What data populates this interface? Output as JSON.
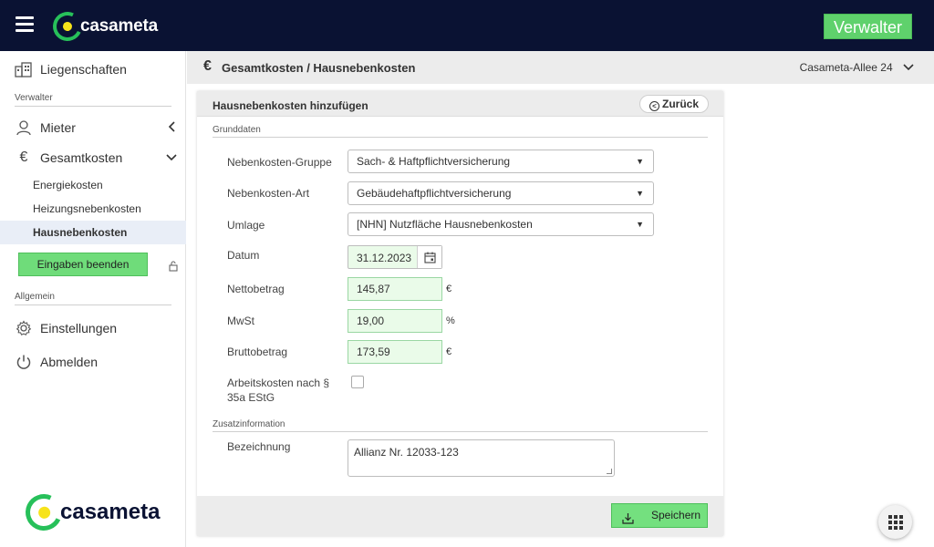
{
  "header": {
    "logo_text": "casameta",
    "role_badge": "Verwalter"
  },
  "sidebar": {
    "items": {
      "liegenschaften": "Liegenschaften",
      "mieter": "Mieter",
      "gesamtkosten": "Gesamtkosten",
      "einstellungen": "Einstellungen",
      "abmelden": "Abmelden"
    },
    "sections": {
      "verwalter": "Verwalter",
      "allgemein": "Allgemein"
    },
    "sub_items": {
      "energiekosten": "Energiekosten",
      "heizungsnebenkosten": "Heizungsnebenkosten",
      "hausnebenkosten": "Hausnebenkosten"
    },
    "finish_button": "Eingaben beenden",
    "logo_text": "casameta"
  },
  "page": {
    "currency_symbol": "€",
    "title": "Gesamtkosten / Hausnebenkosten",
    "property_selector": "Casameta-Allee 24"
  },
  "form": {
    "title": "Hausnebenkosten hinzufügen",
    "back_label": "Zurück",
    "groups": {
      "basic": "Grunddaten",
      "extra": "Zusatzinformation"
    },
    "labels": {
      "gruppe": "Nebenkosten-Gruppe",
      "art": "Nebenkosten-Art",
      "umlage": "Umlage",
      "datum": "Datum",
      "netto": "Nettobetrag",
      "mwst": "MwSt",
      "brutto": "Bruttobetrag",
      "arbeitskosten_line1": "Arbeitskosten nach §",
      "arbeitskosten_line2": "35a EStG",
      "bezeichnung": "Bezeichnung"
    },
    "values": {
      "gruppe": "Sach- & Haftpflichtversicherung",
      "art": "Gebäudehaftpflichtversicherung",
      "umlage": "[NHN] Nutzfläche Hausnebenkosten",
      "datum": "31.12.2023",
      "netto": "145,87",
      "mwst": "19,00",
      "brutto": "173,59",
      "arbeitskosten_checked": false,
      "bezeichnung": "Allianz Nr. 12033-123"
    },
    "units": {
      "netto": "€",
      "mwst": "%",
      "brutto": "€"
    },
    "save_label": "Speichern"
  },
  "colors": {
    "topbar": "#0a1233",
    "accent_green": "#5fd16c",
    "input_green": "#eafbe9"
  }
}
